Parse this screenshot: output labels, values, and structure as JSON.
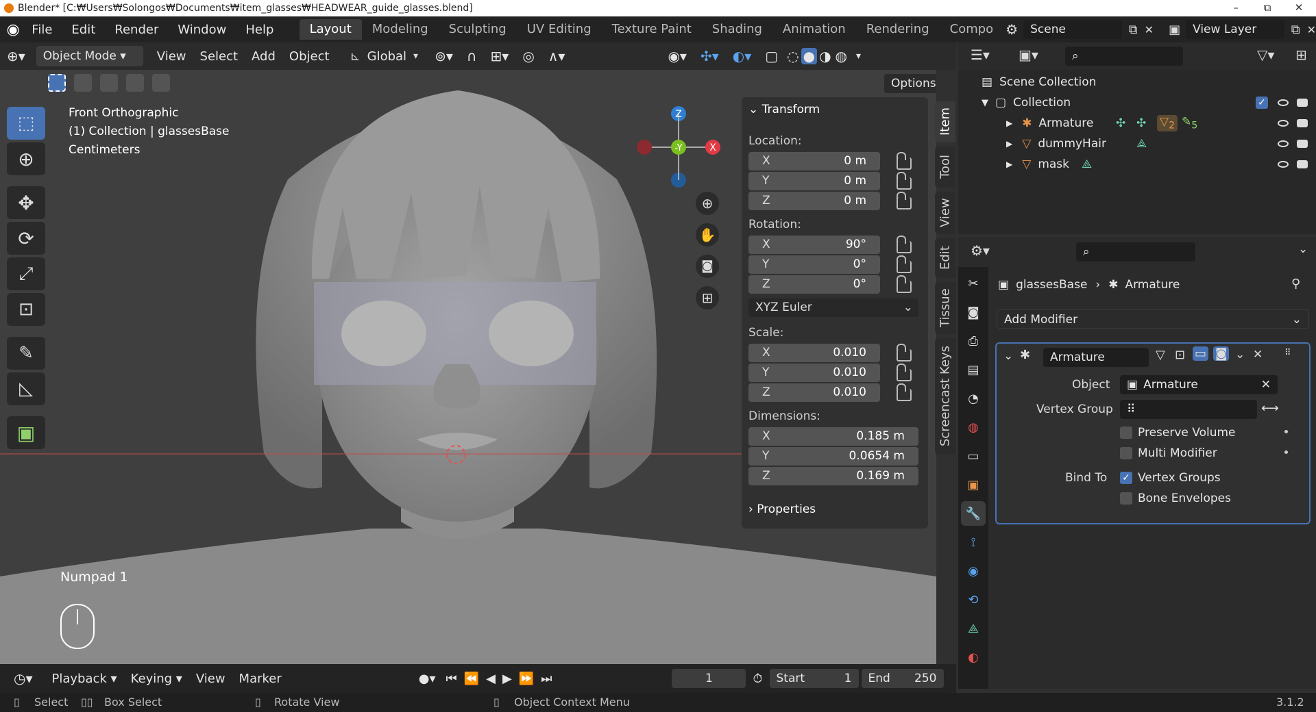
{
  "titlebar": {
    "title": "Blender* [C:₩Users₩Solongos₩Documents₩item_glasses₩HEADWEAR_guide_glasses.blend]",
    "minimize": "–",
    "maximize": "⧉",
    "close": "✕"
  },
  "menu": [
    "File",
    "Edit",
    "Render",
    "Window",
    "Help"
  ],
  "workspaces": [
    "Layout",
    "Modeling",
    "Sculpting",
    "UV Editing",
    "Texture Paint",
    "Shading",
    "Animation",
    "Rendering",
    "Compo"
  ],
  "scene": {
    "name": "Scene",
    "view_layer": "View Layer"
  },
  "viewport_header": {
    "mode": "Object Mode",
    "view": "View",
    "select": "Select",
    "add": "Add",
    "object": "Object",
    "orientation": "Global",
    "options": "Options"
  },
  "viewport_info": {
    "view_name": "Front Orthographic",
    "collection": "(1) Collection | glassesBase",
    "units": "Centimeters",
    "key_hint": "Numpad 1"
  },
  "gizmo": {
    "z": "Z",
    "y": "-Y",
    "x": "X"
  },
  "npanel": {
    "transform_title": "Transform",
    "location_label": "Location:",
    "location": [
      {
        "ax": "X",
        "val": "0 m"
      },
      {
        "ax": "Y",
        "val": "0 m"
      },
      {
        "ax": "Z",
        "val": "0 m"
      }
    ],
    "rotation_label": "Rotation:",
    "rotation": [
      {
        "ax": "X",
        "val": "90°"
      },
      {
        "ax": "Y",
        "val": "0°"
      },
      {
        "ax": "Z",
        "val": "0°"
      }
    ],
    "rotation_mode": "XYZ Euler",
    "scale_label": "Scale:",
    "scale": [
      {
        "ax": "X",
        "val": "0.010"
      },
      {
        "ax": "Y",
        "val": "0.010"
      },
      {
        "ax": "Z",
        "val": "0.010"
      }
    ],
    "dimensions_label": "Dimensions:",
    "dimensions": [
      {
        "ax": "X",
        "val": "0.185 m"
      },
      {
        "ax": "Y",
        "val": "0.0654 m"
      },
      {
        "ax": "Z",
        "val": "0.169 m"
      }
    ],
    "properties_title": "Properties"
  },
  "side_tabs": [
    "Item",
    "Tool",
    "View",
    "Edit",
    "Tissue",
    "Screencast Keys"
  ],
  "outliner": {
    "scene_collection": "Scene Collection",
    "collection": "Collection",
    "items": [
      {
        "name": "Armature",
        "badge1": "2",
        "badge2": "5"
      },
      {
        "name": "dummyHair"
      },
      {
        "name": "mask"
      }
    ]
  },
  "properties": {
    "breadcrumb_object": "glassesBase",
    "breadcrumb_modifier": "Armature",
    "add_modifier": "Add Modifier",
    "modifier_name": "Armature",
    "object_label": "Object",
    "object_value": "Armature",
    "vertex_group_label": "Vertex Group",
    "preserve_volume": "Preserve Volume",
    "multi_modifier": "Multi Modifier",
    "bind_to_label": "Bind To",
    "vertex_groups": "Vertex Groups",
    "bone_envelopes": "Bone Envelopes"
  },
  "timeline": {
    "playback": "Playback",
    "keying": "Keying",
    "view": "View",
    "marker": "Marker",
    "frame": "1",
    "start_label": "Start",
    "start": "1",
    "end_label": "End",
    "end": "250"
  },
  "statusbar": {
    "select": "Select",
    "box_select": "Box Select",
    "rotate_view": "Rotate View",
    "context_menu": "Object Context Menu",
    "version": "3.1.2"
  },
  "colors": {
    "accent": "#4772b3",
    "gizmo_x": "#e23a44",
    "gizmo_y": "#7bbf20",
    "gizmo_z": "#2f7fd3",
    "modifier_icon": "#5aa3ef"
  }
}
